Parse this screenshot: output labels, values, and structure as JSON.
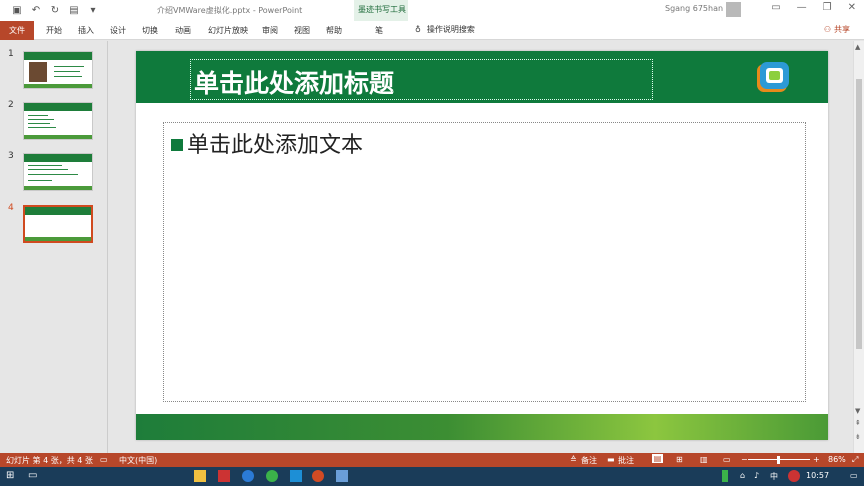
{
  "window": {
    "title": "介绍VMWare虚拟化.pptx  -  PowerPoint",
    "context_tab_group": "墨迹书写工具",
    "user": "Sgang 675han"
  },
  "ribbon": {
    "tabs": [
      "文件",
      "开始",
      "插入",
      "设计",
      "切换",
      "动画",
      "幻灯片放映",
      "审阅",
      "视图",
      "帮助",
      "笔"
    ],
    "search_label": "操作说明搜索",
    "share_label": "共享"
  },
  "thumbnails": [
    {
      "number": "1"
    },
    {
      "number": "2"
    },
    {
      "number": "3"
    },
    {
      "number": "4"
    }
  ],
  "slide": {
    "title_placeholder": "单击此处添加标题",
    "body_placeholder": "单击此处添加文本"
  },
  "status": {
    "slide_info": "幻灯片 第 4 张，共 4 张",
    "language": "中文(中国)",
    "notes": "备注",
    "comments": "批注",
    "zoom": "86%"
  },
  "taskbar": {
    "ime": "中",
    "time": "10:57"
  },
  "colors": {
    "accent": "#b7472a",
    "slide_green": "#0f7a3c"
  }
}
